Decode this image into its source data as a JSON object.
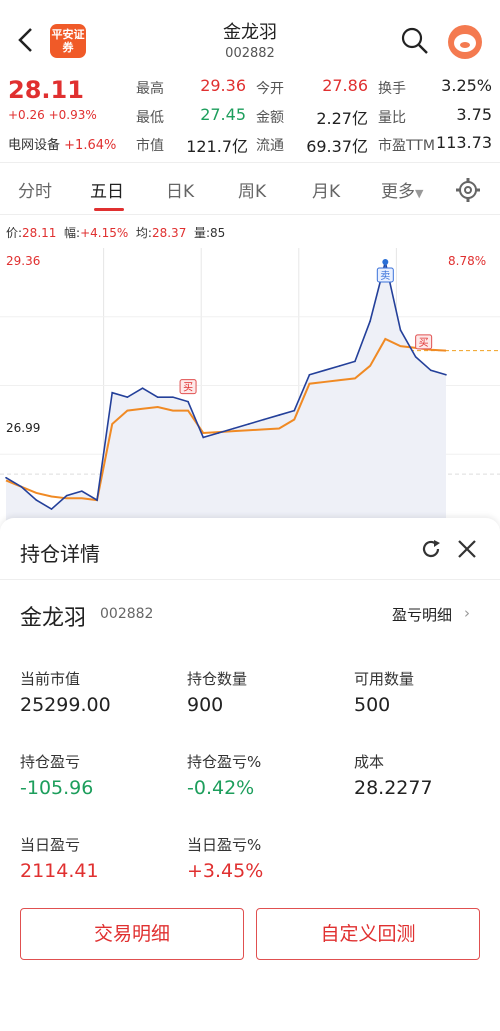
{
  "header": {
    "title": "金龙羽",
    "code": "002882",
    "logo_text": "平安证券"
  },
  "quote": {
    "price": "28.11",
    "change": "+0.26 +0.93%",
    "sector_name": "电网设备",
    "sector_change": "+1.64%",
    "stats": [
      {
        "label": "最高",
        "value": "29.36",
        "color": "red"
      },
      {
        "label": "今开",
        "value": "27.86",
        "color": "red"
      },
      {
        "label": "换手",
        "value": "3.25%",
        "color": "dark"
      },
      {
        "label": "最低",
        "value": "27.45",
        "color": "green"
      },
      {
        "label": "金额",
        "value": "2.27亿",
        "color": "dark"
      },
      {
        "label": "量比",
        "value": "3.75",
        "color": "dark"
      },
      {
        "label": "市值",
        "value": "121.7亿",
        "color": "dark"
      },
      {
        "label": "流通",
        "value": "69.37亿",
        "color": "dark"
      },
      {
        "label": "市盈TTM",
        "value": "113.73",
        "color": "dark"
      }
    ]
  },
  "tabs": [
    {
      "label": "分时",
      "active": false
    },
    {
      "label": "五日",
      "active": true
    },
    {
      "label": "日K",
      "active": false
    },
    {
      "label": "周K",
      "active": false
    },
    {
      "label": "月K",
      "active": false
    },
    {
      "label": "更多",
      "active": false
    }
  ],
  "infobar": {
    "price_label": "价:",
    "price": "28.11",
    "amp_label": "幅:",
    "amp": "+4.15%",
    "avg_label": "均:",
    "avg": "28.37",
    "vol_label": "量:",
    "vol": "85"
  },
  "chart_data": {
    "type": "line",
    "y_top_label": "29.36",
    "y_mid_label": "26.99",
    "pct_top_label": "8.78%",
    "series": [
      {
        "values": [
          26.95,
          26.85,
          26.7,
          26.6,
          26.75,
          26.8,
          26.7,
          27.9,
          27.85,
          27.95,
          27.85,
          27.85,
          27.8,
          27.4,
          27.45,
          27.5,
          27.55,
          27.6,
          27.65,
          27.7,
          28.1,
          28.15,
          28.2,
          28.25,
          28.7,
          29.36,
          28.6,
          28.3,
          28.15,
          28.1
        ]
      },
      {
        "values": [
          26.92,
          26.85,
          26.78,
          26.74,
          26.72,
          26.72,
          26.7,
          27.55,
          27.7,
          27.72,
          27.74,
          27.7,
          27.7,
          27.45,
          27.46,
          27.47,
          27.48,
          27.49,
          27.5,
          27.6,
          28.0,
          28.02,
          28.04,
          28.06,
          28.2,
          28.5,
          28.42,
          28.4,
          28.38,
          28.37
        ]
      }
    ],
    "markers": [
      {
        "label": "买",
        "index": 12
      },
      {
        "label": "卖",
        "index": 25
      },
      {
        "label": "买",
        "index": 27
      }
    ],
    "colors": {
      "price": "#24409a",
      "avg": "#f08a24",
      "ref": "#f0a020",
      "fill": "#eef0f7"
    }
  },
  "panel": {
    "title": "持仓详情",
    "stock_name": "金龙羽",
    "stock_code": "002882",
    "pl_link": "盈亏明细",
    "fields": [
      {
        "label": "当前市值",
        "value": "25299.00",
        "color": "dark"
      },
      {
        "label": "持仓数量",
        "value": "900",
        "color": "dark"
      },
      {
        "label": "可用数量",
        "value": "500",
        "color": "dark"
      },
      {
        "label": "持仓盈亏",
        "value": "-105.96",
        "color": "green"
      },
      {
        "label": "持仓盈亏%",
        "value": "-0.42%",
        "color": "green"
      },
      {
        "label": "成本",
        "value": "28.2277",
        "color": "dark"
      },
      {
        "label": "当日盈亏",
        "value": "2114.41",
        "color": "red"
      },
      {
        "label": "当日盈亏%",
        "value": "+3.45%",
        "color": "red"
      }
    ],
    "buttons": [
      "交易明细",
      "自定义回测"
    ]
  }
}
